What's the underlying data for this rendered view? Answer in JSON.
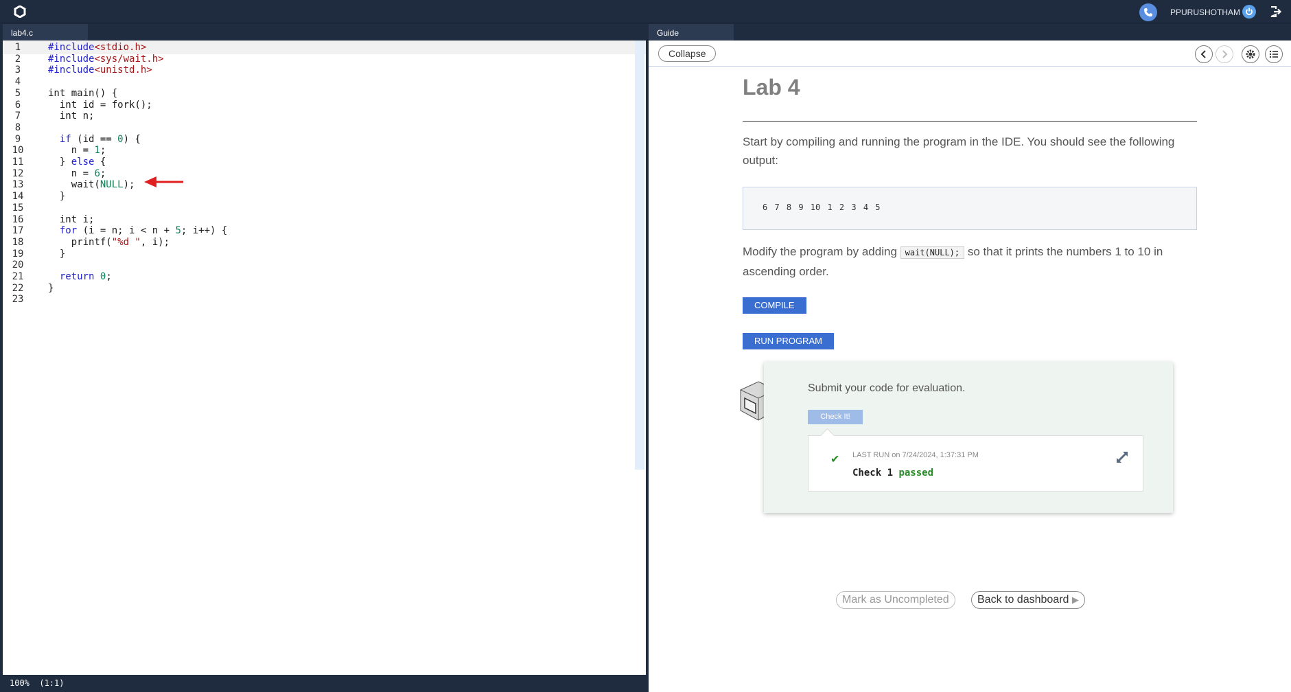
{
  "topbar": {
    "username": "PPURUSHOTHAM",
    "logo_icon": "codio-logo-icon",
    "phone_icon": "phone-icon",
    "power_icon": "power-icon",
    "logout_icon": "logout-icon"
  },
  "editor": {
    "tab_label": "lab4.c",
    "status": "100%  (1:1)",
    "lines": [
      {
        "n": "1",
        "text": "#include<stdio.h>"
      },
      {
        "n": "2",
        "text": "#include<sys/wait.h>"
      },
      {
        "n": "3",
        "text": "#include<unistd.h>"
      },
      {
        "n": "4",
        "text": ""
      },
      {
        "n": "5",
        "text": "int main() {"
      },
      {
        "n": "6",
        "text": "  int id = fork();"
      },
      {
        "n": "7",
        "text": "  int n;"
      },
      {
        "n": "8",
        "text": ""
      },
      {
        "n": "9",
        "text": "  if (id == 0) {"
      },
      {
        "n": "10",
        "text": "    n = 1;"
      },
      {
        "n": "11",
        "text": "  } else {"
      },
      {
        "n": "12",
        "text": "    n = 6;"
      },
      {
        "n": "13",
        "text": "    wait(NULL);"
      },
      {
        "n": "14",
        "text": "  }"
      },
      {
        "n": "15",
        "text": ""
      },
      {
        "n": "16",
        "text": "  int i;"
      },
      {
        "n": "17",
        "text": "  for (i = n; i < n + 5; i++) {"
      },
      {
        "n": "18",
        "text": "    printf(\"%d \", i);"
      },
      {
        "n": "19",
        "text": "  }"
      },
      {
        "n": "20",
        "text": ""
      },
      {
        "n": "21",
        "text": "  return 0;"
      },
      {
        "n": "22",
        "text": "}"
      },
      {
        "n": "23",
        "text": ""
      }
    ]
  },
  "guide": {
    "tab_label": "Guide",
    "collapse_label": "Collapse",
    "title": "Lab 4",
    "intro": "Start by compiling and running the program in the IDE. You should see the following output:",
    "output": "6 7 8 9 10 1 2 3 4 5",
    "modify_before": "Modify the program by adding",
    "modify_code": "wait(NULL);",
    "modify_after": "so that it prints the numbers 1 to 10 in ascending order.",
    "compile_label": "COMPILE",
    "run_label": "RUN PROGRAM",
    "submit_text": "Submit your code for evaluation.",
    "check_label": "Check It!",
    "last_run_prefix": "LAST RUN",
    "last_run_date": "on 7/24/2024, 1:37:31 PM",
    "check_text": "Check 1",
    "passed_text": "passed",
    "mark_uncompleted_label": "Mark as Uncompleted",
    "back_label": "Back to dashboard"
  },
  "colors": {
    "topbar": "#1f2c3f",
    "accent": "#3a6fd1",
    "passed": "#2a8a2a"
  }
}
